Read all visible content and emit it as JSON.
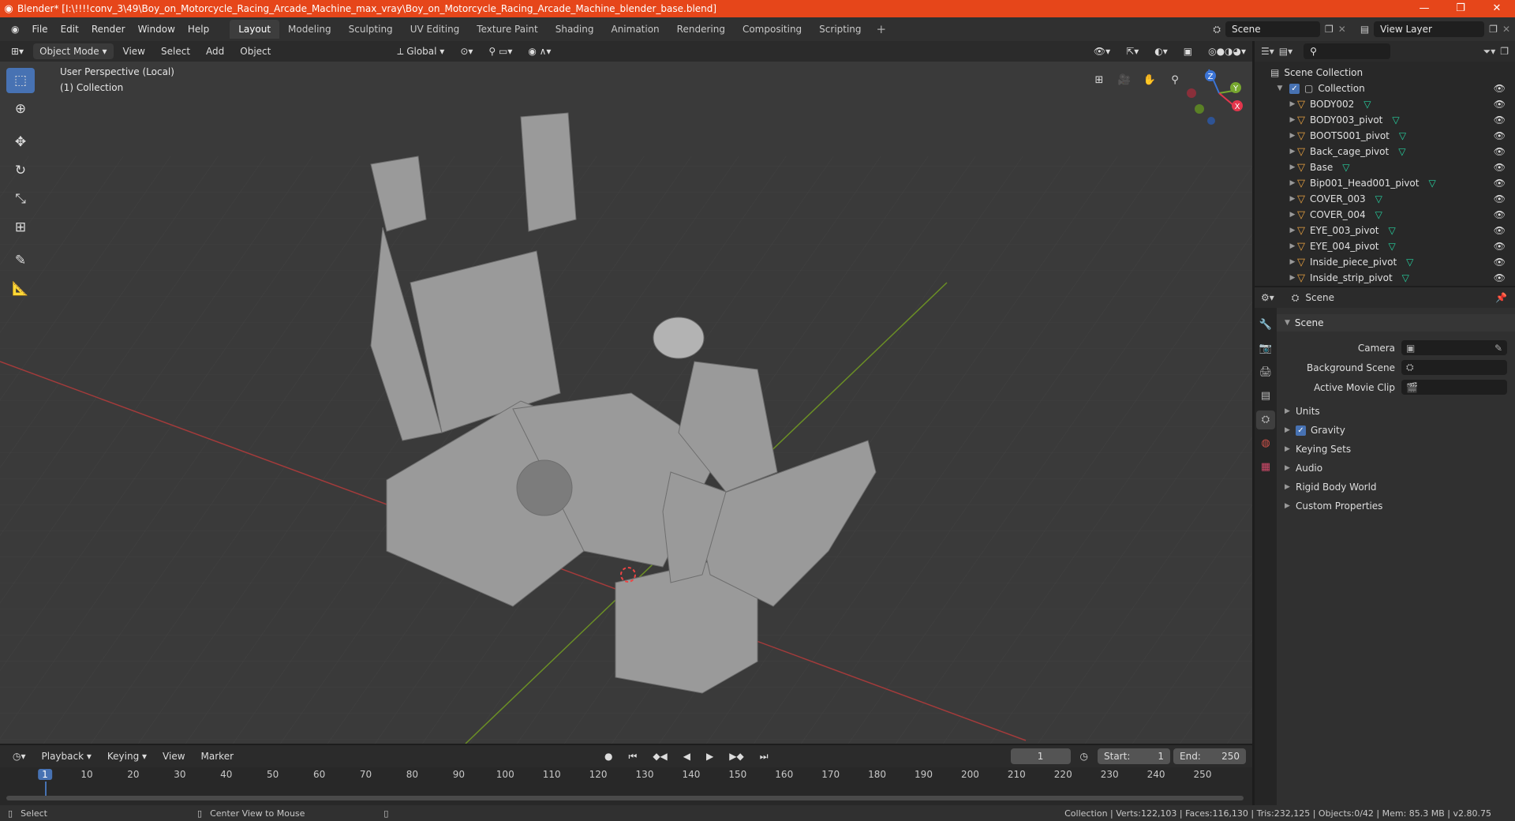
{
  "window": {
    "title": "Blender* [I:\\!!!!conv_3\\49\\Boy_on_Motorcycle_Racing_Arcade_Machine_max_vray\\Boy_on_Motorcycle_Racing_Arcade_Machine_blender_base.blend]"
  },
  "menu": [
    "File",
    "Edit",
    "Render",
    "Window",
    "Help"
  ],
  "workspaces": [
    "Layout",
    "Modeling",
    "Sculpting",
    "UV Editing",
    "Texture Paint",
    "Shading",
    "Animation",
    "Rendering",
    "Compositing",
    "Scripting"
  ],
  "top_right": {
    "scene": "Scene",
    "view_layer": "View Layer"
  },
  "viewport_header": {
    "mode": "Object Mode",
    "menus": [
      "View",
      "Select",
      "Add",
      "Object"
    ],
    "orientation": "Global"
  },
  "viewport": {
    "perspective": "User Perspective (Local)",
    "collection": "(1) Collection"
  },
  "gizmo": {
    "z": "Z",
    "y": "Y",
    "x": "X"
  },
  "outliner": {
    "root": "Scene Collection",
    "collection": "Collection",
    "items": [
      "BODY002",
      "BODY003_pivot",
      "BOOTS001_pivot",
      "Back_cage_pivot",
      "Base",
      "Bip001_Head001_pivot",
      "COVER_003",
      "COVER_004",
      "EYE_003_pivot",
      "EYE_004_pivot",
      "Inside_piece_pivot",
      "Inside_strip_pivot"
    ]
  },
  "properties": {
    "context": "Scene",
    "panel": "Scene",
    "fields": [
      {
        "label": "Camera"
      },
      {
        "label": "Background Scene"
      },
      {
        "label": "Active Movie Clip"
      }
    ],
    "subpanels": [
      "Units",
      "Gravity",
      "Keying Sets",
      "Audio",
      "Rigid Body World",
      "Custom Properties"
    ]
  },
  "timeline": {
    "menus": [
      "Playback",
      "Keying",
      "View",
      "Marker"
    ],
    "current_frame": "1",
    "start_label": "Start:",
    "start": "1",
    "end_label": "End:",
    "end": "250",
    "ticks": [
      "1",
      "10",
      "20",
      "30",
      "40",
      "50",
      "60",
      "70",
      "80",
      "90",
      "100",
      "110",
      "120",
      "130",
      "140",
      "150",
      "160",
      "170",
      "180",
      "190",
      "200",
      "210",
      "220",
      "230",
      "240",
      "250"
    ]
  },
  "statusbar": {
    "left": "Select",
    "middle": "Center View to Mouse",
    "right": "Collection | Verts:122,103 | Faces:116,130 | Tris:232,125 | Objects:0/42 | Mem: 85.3 MB | v2.80.75"
  },
  "colors": {
    "accent": "#4772b3",
    "titlebar": "#e6461a",
    "object": "#e8a140",
    "mesh": "#27d1a0"
  }
}
